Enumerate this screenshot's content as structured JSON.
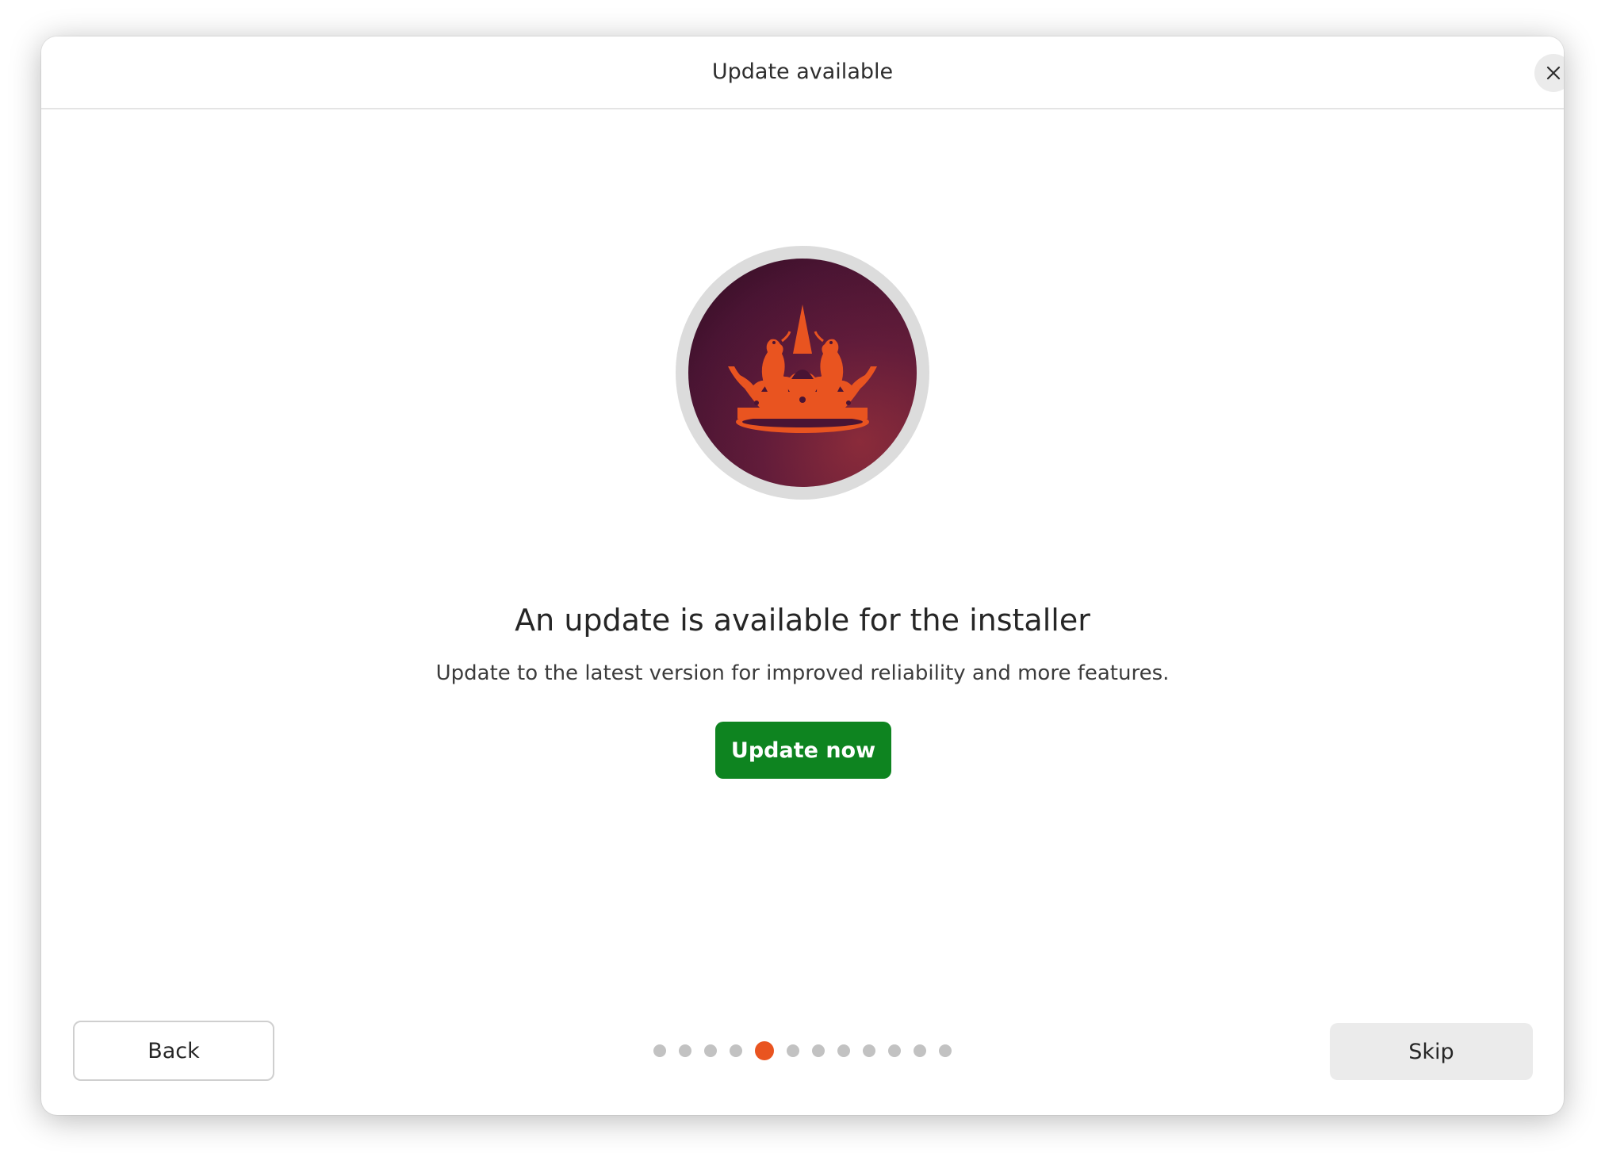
{
  "window": {
    "title": "Update available",
    "close_icon": "close-icon"
  },
  "main": {
    "hero_icon": "ubuntu-crown-logo-icon",
    "headline": "An update is available for the installer",
    "subtext": "Update to the latest version for improved reliability and more features.",
    "update_button_label": "Update now"
  },
  "footer": {
    "back_label": "Back",
    "skip_label": "Skip",
    "pager": {
      "total_steps": 12,
      "current_step": 5
    }
  },
  "colors": {
    "accent": "#e95420",
    "primary_button": "#0e8420",
    "logo_background": "#4a1434",
    "inactive_dot": "#c2c2c2"
  }
}
